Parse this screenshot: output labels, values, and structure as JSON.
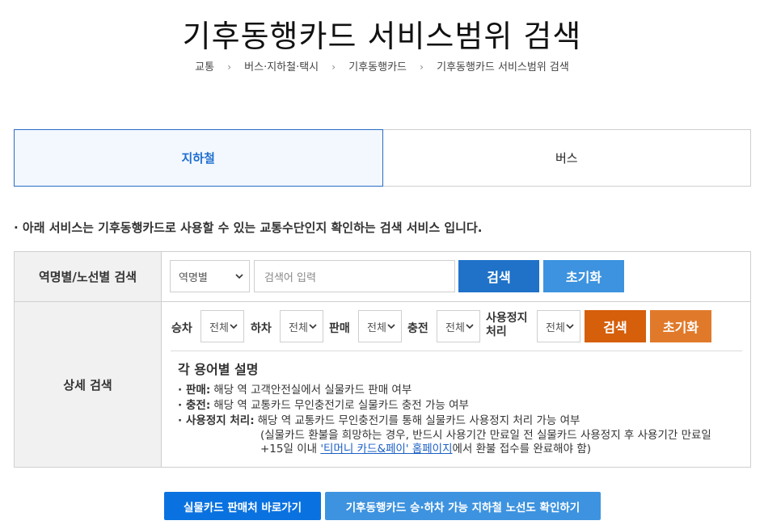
{
  "title": "기후동행카드 서비스범위 검색",
  "breadcrumb": [
    "교통",
    "버스·지하철·택시",
    "기후동행카드",
    "기후동행카드 서비스범위 검색"
  ],
  "tabs": [
    {
      "label": "지하철",
      "active": true
    },
    {
      "label": "버스",
      "active": false
    }
  ],
  "notice": "· 아래 서비스는 기후동행카드로 사용할 수 있는 교통수단인지 확인하는 검색 서비스 입니다.",
  "station_search": {
    "label": "역명별/노선별 검색",
    "select_value": "역명별",
    "input_placeholder": "검색어 입력",
    "search_label": "검색",
    "reset_label": "초기화"
  },
  "detail_search": {
    "label": "상세 검색",
    "filters": [
      {
        "label": "승차",
        "value": "전체"
      },
      {
        "label": "하차",
        "value": "전체"
      },
      {
        "label": "판매",
        "value": "전체"
      },
      {
        "label": "충전",
        "value": "전체"
      },
      {
        "label": "사용정지 처리",
        "value": "전체"
      }
    ],
    "search_label": "검색",
    "reset_label": "초기화"
  },
  "glossary": {
    "title": "각 용어별 설명",
    "items": [
      {
        "term": "판매:",
        "text": "해당 역 고객안전실에서 실물카드 판매 여부"
      },
      {
        "term": "충전:",
        "text": "해당 역 교통카드 무인충전기로 실물카드 충전 가능 여부"
      },
      {
        "term": "사용정지 처리:",
        "text": "해당 역 교통카드 무인충전기를 통해 실물카드 사용정지 처리 가능 여부"
      }
    ],
    "note_line1": "(실물카드 환불을 희망하는 경우, 반드시 사용기간 만료일 전 실물카드 사용정지 후 사용기간 만료일",
    "note_line2_pre": "+15일 이내 ",
    "note_link": "'티머니 카드&페이' 홈페이지",
    "note_line2_post": "에서 환불 접수를 완료해야 함)"
  },
  "bottom_buttons": [
    {
      "label": "실물카드 판매처 바로가기"
    },
    {
      "label": "기후동행카드 승·하차 가능 지하철 노선도 확인하기"
    }
  ],
  "colors": {
    "primary_blue": "#1f72c8",
    "light_blue": "#3d93df",
    "orange": "#d55f0a",
    "light_orange": "#e07a2a",
    "bottom_blue": "#0a72e0"
  }
}
